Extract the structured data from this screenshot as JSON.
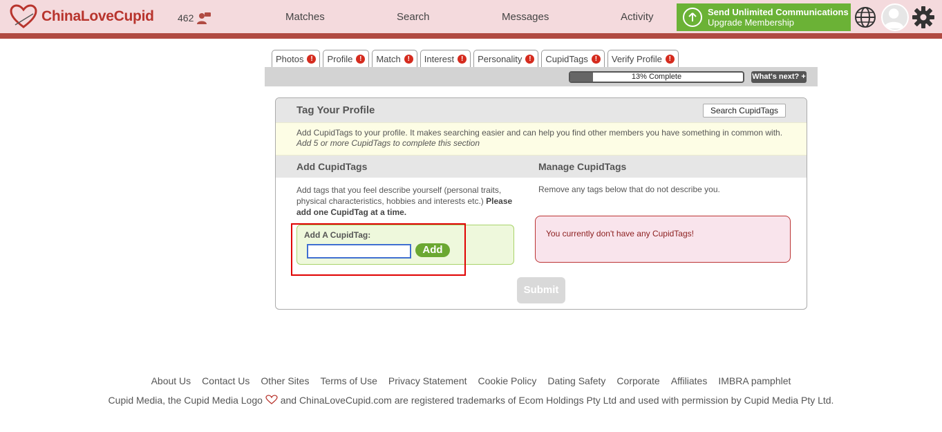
{
  "header": {
    "brand": "ChinaLoveCupid",
    "counter": "462",
    "nav": [
      "Matches",
      "Search",
      "Messages",
      "Activity"
    ],
    "upgrade": {
      "line1": "Send Unlimited Communications",
      "line2": "Upgrade Membership"
    },
    "icons": [
      "globe-icon",
      "avatar",
      "gear-icon"
    ],
    "colors": {
      "header_bg": "#f4dadd",
      "accent": "#b04a42",
      "upgrade_green": "#6bb236"
    }
  },
  "tabs": [
    {
      "label": "Photos",
      "warn": "!"
    },
    {
      "label": "Profile",
      "warn": "!"
    },
    {
      "label": "Match",
      "warn": "!"
    },
    {
      "label": "Interest",
      "warn": "!"
    },
    {
      "label": "Personality",
      "warn": "!"
    },
    {
      "label": "CupidTags",
      "warn": "!"
    },
    {
      "label": "Verify Profile",
      "warn": "!"
    }
  ],
  "progress": {
    "text": "13% Complete",
    "value": 0.13,
    "whats_next": "What's next? +"
  },
  "panel": {
    "title": "Tag Your Profile",
    "search_button": "Search CupidTags",
    "info_line1": "Add CupidTags to your profile. It makes searching easier and can help you find other members you have something in common with.",
    "info_line2": "Add 5 or more CupidTags to complete this section",
    "add_heading": "Add CupidTags",
    "manage_heading": "Manage CupidTags",
    "add_desc": "Add tags that you feel describe yourself (personal traits, physical characteristics, hobbies and interests etc.)",
    "add_desc_bold": "Please add one CupidTag at a time.",
    "remove_desc": "Remove any tags below that do not describe you.",
    "add_label": "Add A CupidTag:",
    "add_input_value": "",
    "add_button": "Add",
    "empty_message": "You currently don't have any CupidTags!",
    "submit": "Submit"
  },
  "footer": {
    "links": [
      "About Us",
      "Contact Us",
      "Other Sites",
      "Terms of Use",
      "Privacy Statement",
      "Cookie Policy",
      "Dating Safety",
      "Corporate",
      "Affiliates",
      "IMBRA pamphlet"
    ],
    "legal_before": "Cupid Media, the Cupid Media Logo",
    "legal_after": "and ChinaLoveCupid.com are registered trademarks of Ecom Holdings Pty Ltd and used with permission by Cupid Media Pty Ltd."
  }
}
